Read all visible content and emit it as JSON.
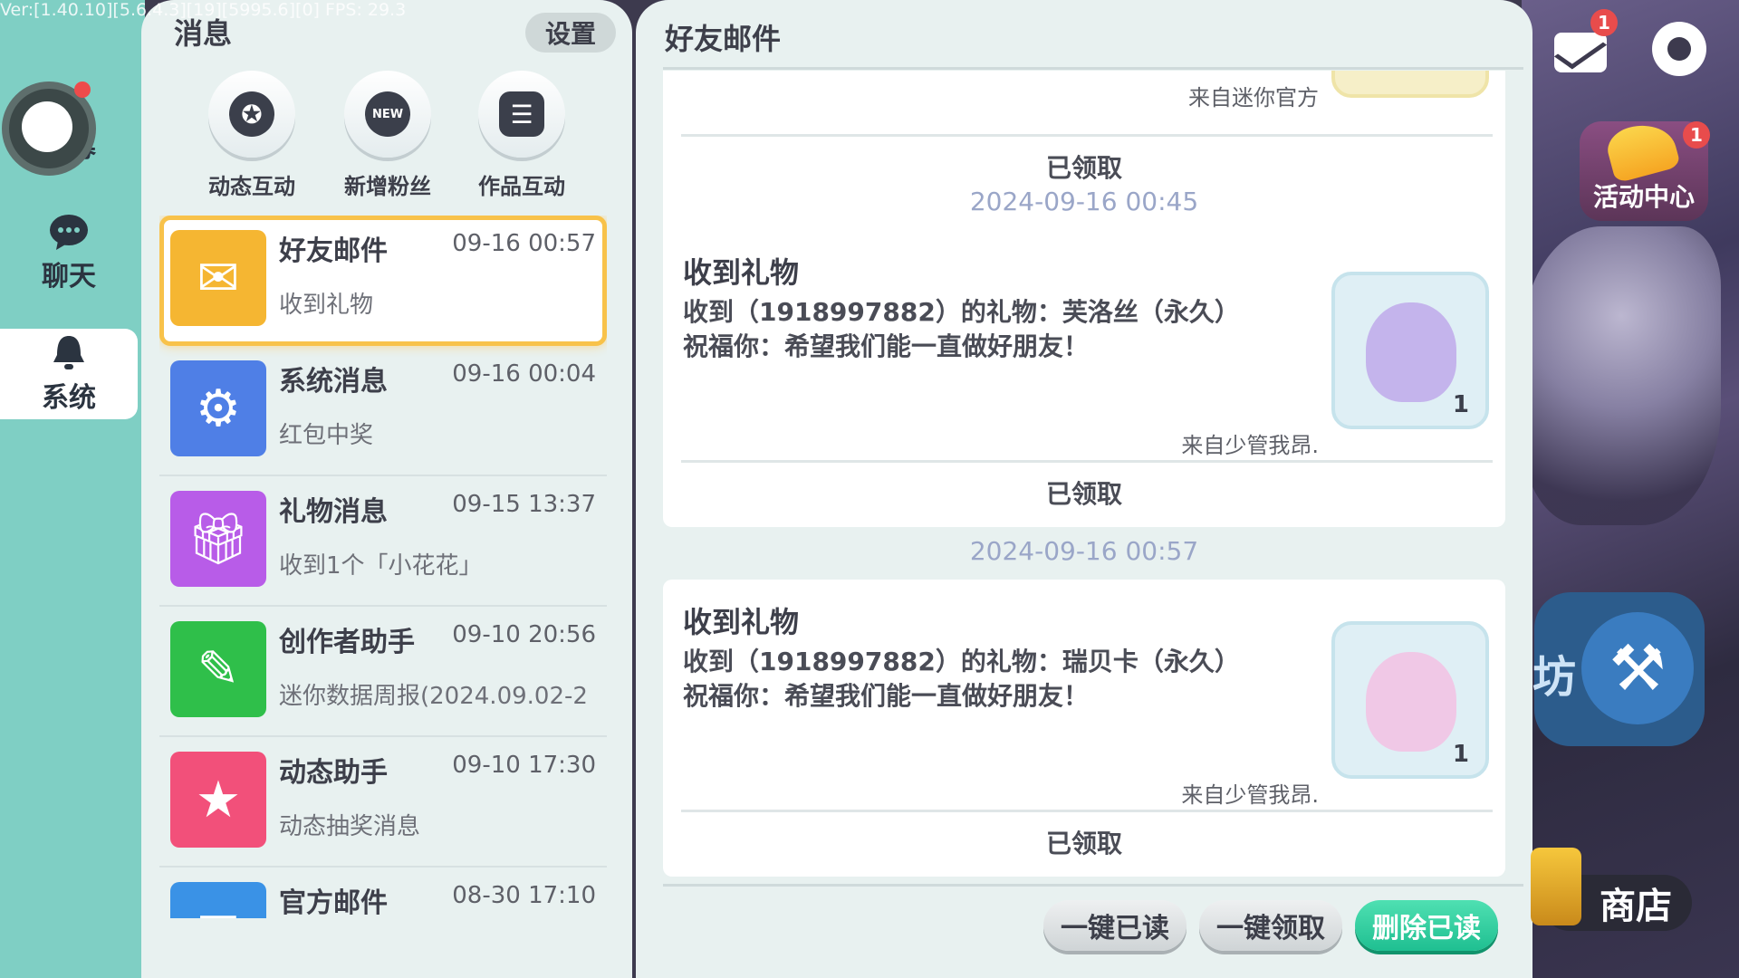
{
  "debug": "Ver:[1.40.10][5.6.4.3][19][5995.6][0] FPS: 29.3",
  "sidebar": {
    "recruit_label": "招募",
    "items": [
      {
        "label": "聊天",
        "icon": "chat-bubble-icon"
      },
      {
        "label": "系统",
        "icon": "bell-icon",
        "active": true
      }
    ]
  },
  "messages": {
    "title": "消息",
    "settings_label": "设置",
    "quick_actions": [
      {
        "label": "动态互动",
        "icon": "star-bubble-icon"
      },
      {
        "label": "新增粉丝",
        "icon": "new-follower-icon",
        "glyph": "NEW"
      },
      {
        "label": "作品互动",
        "icon": "list-icon"
      }
    ],
    "rows": [
      {
        "name": "好友邮件",
        "time": "09-16 00:57",
        "sub": "收到礼物",
        "icon": "friend-mail-icon",
        "color": "#f5b632",
        "selected": true
      },
      {
        "name": "系统消息",
        "time": "09-16 00:04",
        "sub": "红包中奖",
        "icon": "gear-icon",
        "color": "#4f7fe6"
      },
      {
        "name": "礼物消息",
        "time": "09-15 13:37",
        "sub": "收到1个「小花花」",
        "icon": "gift-icon",
        "color": "#b85ce8"
      },
      {
        "name": "创作者助手",
        "time": "09-10 20:56",
        "sub": "迷你数据周报(2024.09.02-2",
        "icon": "pencil-ruler-icon",
        "color": "#2fbf4a"
      },
      {
        "name": "动态助手",
        "time": "09-10 17:30",
        "sub": "动态抽奖消息",
        "icon": "bookmark-star-icon",
        "color": "#f2507a"
      },
      {
        "name": "官方邮件",
        "time": "08-30 17:10",
        "sub": "",
        "icon": "official-mail-icon",
        "color": "#3a92e6"
      }
    ]
  },
  "mail": {
    "title": "好友邮件",
    "top_card": {
      "from": "来自迷你官方",
      "claim": "已领取"
    },
    "cards": [
      {
        "date": "2024-09-16 00:45",
        "title": "收到礼物",
        "line1": "收到（1918997882）的礼物：芙洛丝（永久）",
        "line2": "祝福你：希望我们能一直做好朋友！",
        "from": "来自少管我昂.",
        "claim": "已领取",
        "count": "1",
        "face_color": "#c4b4ec"
      },
      {
        "date": "2024-09-16 00:57",
        "title": "收到礼物",
        "line1": "收到（1918997882）的礼物：瑞贝卡（永久）",
        "line2": "祝福你：希望我们能一直做好朋友！",
        "from": "来自少管我昂.",
        "claim": "已领取",
        "count": "1",
        "face_color": "#f0c8e6"
      }
    ],
    "buttons": {
      "read_all": "一键已读",
      "claim_all": "一键领取",
      "delete_read": "删除已读"
    }
  },
  "hud": {
    "mail_badge": "1",
    "event_label": "活动中心",
    "event_badge": "1",
    "build_label": "坊",
    "shop_label": "商店"
  }
}
